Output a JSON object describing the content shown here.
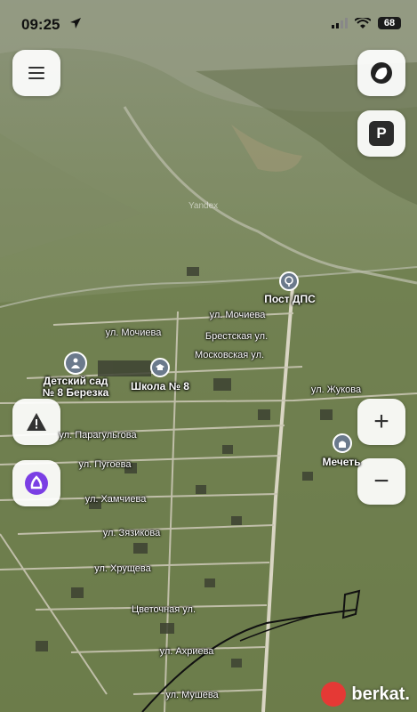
{
  "status_bar": {
    "time": "09:25",
    "battery": "68"
  },
  "map": {
    "watermark": "Yandex",
    "street_labels": [
      "ул. Мочиева",
      "ул. Мочиева",
      "Брестская ул.",
      "Московская ул.",
      "ул. Жукова",
      "ул. Парагульгова",
      "ул. Пугоева",
      "ул. Хамчиева",
      "ул. Зязикова",
      "ул. Хрущева",
      "Цветочная ул.",
      "ул. Ахриева",
      "ул. Мушева"
    ],
    "pois": [
      {
        "name": "Пост ДПС",
        "icon": "police-post-icon"
      },
      {
        "name": "Детский сад\n№ 8 Березка",
        "icon": "kindergarten-icon"
      },
      {
        "name": "Школа № 8",
        "icon": "school-icon"
      },
      {
        "name": "Мечеть",
        "icon": "mosque-icon"
      }
    ]
  },
  "controls": {
    "menu": "menu-icon",
    "layers": "layers-icon",
    "parking_label": "P",
    "alert": "warning-icon",
    "assistant": "alice-icon",
    "zoom_in_label": "+",
    "zoom_out_label": "−"
  },
  "brand": "berkat."
}
